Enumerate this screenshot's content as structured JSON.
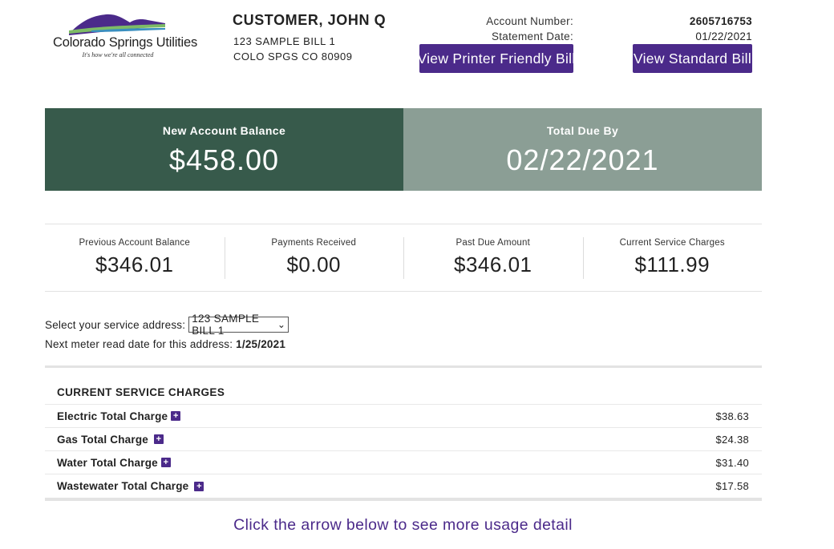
{
  "logo": {
    "name": "Colorado Springs Utilities",
    "tagline": "It's how we're all connected"
  },
  "customer": {
    "name": "CUSTOMER, JOHN Q",
    "address_line1": "123 SAMPLE BILL 1",
    "address_line2": "COLO SPGS CO 80909"
  },
  "account": {
    "number_label": "Account Number:",
    "number": "2605716753",
    "statement_label": "Statement Date:",
    "statement_date": "01/22/2021"
  },
  "buttons": {
    "printer_friendly": "View Printer Friendly Bill",
    "standard": "View Standard Bill"
  },
  "balance": {
    "new_label": "New Account Balance",
    "new_value": "$458.00",
    "due_label": "Total Due By",
    "due_value": "02/22/2021"
  },
  "summary": [
    {
      "label": "Previous Account Balance",
      "value": "$346.01"
    },
    {
      "label": "Payments Received",
      "value": "$0.00"
    },
    {
      "label": "Past Due Amount",
      "value": "$346.01"
    },
    {
      "label": "Current Service Charges",
      "value": "$111.99"
    }
  ],
  "service_address": {
    "label": "Select your service address:",
    "selected": "123 SAMPLE BILL 1",
    "meter_label": "Next meter read date for this address:",
    "meter_date": "1/25/2021"
  },
  "charges": {
    "title": "CURRENT SERVICE CHARGES",
    "rows": [
      {
        "name": "Electric Total Charge",
        "amount": "$38.63"
      },
      {
        "name": "Gas Total Charge",
        "amount": "$24.38"
      },
      {
        "name": "Water Total Charge",
        "amount": "$31.40"
      },
      {
        "name": "Wastewater Total Charge",
        "amount": "$17.58"
      }
    ]
  },
  "more_detail": "Click the arrow below to see more usage detail",
  "colors": {
    "brand_purple": "#4b2a8a",
    "band_dark": "#375a4b",
    "band_light": "#8b9e95"
  }
}
